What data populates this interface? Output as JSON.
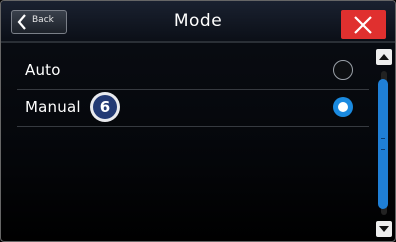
{
  "header": {
    "back_label": "Back",
    "title": "Mode",
    "back_icon": "chevron-left-icon",
    "close_icon": "close-icon"
  },
  "options": [
    {
      "label": "Auto",
      "selected": false
    },
    {
      "label": "Manual",
      "selected": true,
      "badge": "6"
    }
  ],
  "scrollbar": {
    "up_icon": "triangle-up-icon",
    "down_icon": "triangle-down-icon"
  },
  "colors": {
    "accent": "#1a8ae0",
    "close": "#e0302f",
    "badge_bg": "#233a74"
  }
}
